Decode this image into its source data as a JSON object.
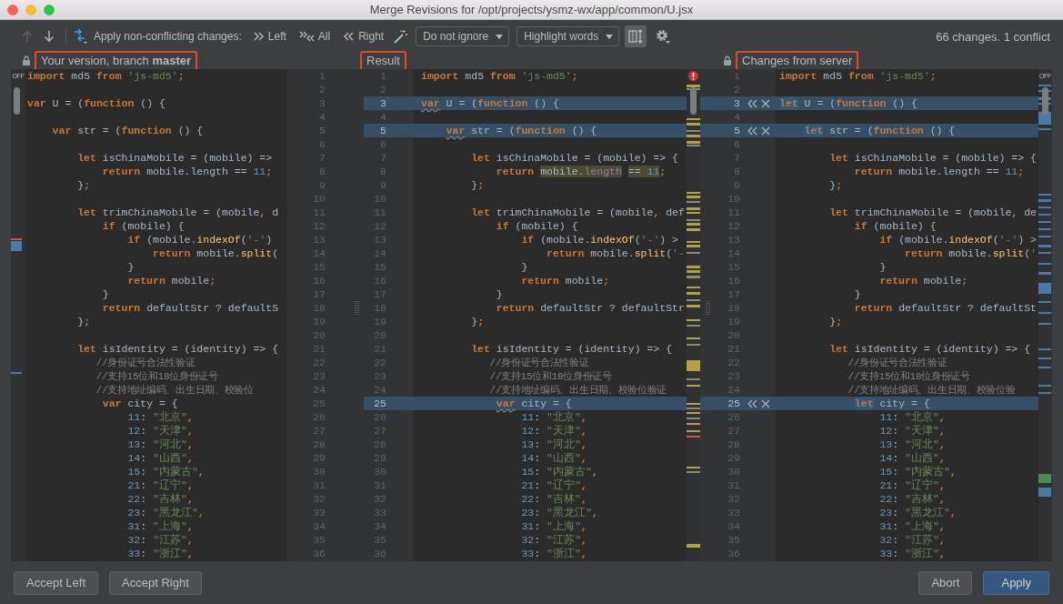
{
  "window": {
    "title": "Merge Revisions for /opt/projects/ysmz-wx/app/common/U.jsx"
  },
  "toolbar": {
    "navigation": [
      {
        "kind": "previous",
        "disabled": true
      },
      {
        "kind": "next",
        "disabled": false
      }
    ],
    "apply_label": "Apply non-conflicting changes:",
    "apply_buttons": [
      {
        "kind": "left",
        "label": "Left"
      },
      {
        "kind": "all",
        "label": "All"
      },
      {
        "kind": "right",
        "label": "Right"
      }
    ],
    "whitespace_dropdown": "Do not ignore",
    "highlight_dropdown": "Highlight words",
    "scroll_sync": {
      "on": true
    },
    "summary": "66 changes. 1 conflict"
  },
  "panes": [
    {
      "title": "Your version, branch **master**",
      "locked": true,
      "annotated": true,
      "inspection_label": "OFF",
      "lines": [
        {
          "number": "1",
          "code": [
            {
              "text": "import",
              "kind": "keyword"
            },
            {
              "text": " md5 ",
              "kind": "plain"
            },
            {
              "text": "from",
              "kind": "keyword"
            },
            {
              "text": " 'js-md5'",
              "kind": "string"
            },
            {
              "text": ";",
              "kind": "keyword"
            }
          ]
        },
        {
          "number": "2"
        },
        {
          "number": "3",
          "code": [
            {
              "text": "var",
              "kind": "keyword"
            },
            {
              "text": " U = (",
              "kind": "plain"
            },
            {
              "text": "function",
              "kind": "keyword"
            },
            {
              "text": " () {",
              "kind": "plain"
            }
          ]
        },
        {
          "number": "4"
        },
        {
          "number": "5",
          "code": [
            {
              "text": "    var",
              "kind": "keyword"
            },
            {
              "text": " str = (",
              "kind": "plain"
            },
            {
              "text": "function",
              "kind": "keyword"
            },
            {
              "text": " () {",
              "kind": "plain"
            }
          ]
        },
        {
          "number": "6"
        },
        {
          "number": "7",
          "code": [
            {
              "text": "        let",
              "kind": "keyword"
            },
            {
              "text": " isChinaMobile = (mobile) =>",
              "kind": "plain"
            }
          ]
        },
        {
          "number": "8",
          "code": [
            {
              "text": "            return",
              "kind": "keyword"
            },
            {
              "text": " mobile.length == ",
              "kind": "plain"
            },
            {
              "text": "11",
              "kind": "number"
            },
            {
              "text": ";",
              "kind": "keyword"
            }
          ]
        },
        {
          "number": "9",
          "code": [
            {
              "text": "        }",
              "kind": "plain"
            },
            {
              "text": ";",
              "kind": "keyword"
            }
          ]
        },
        {
          "number": "10"
        },
        {
          "number": "11",
          "code": [
            {
              "text": "        let",
              "kind": "keyword"
            },
            {
              "text": " trimChinaMobile = (mobile",
              "kind": "plain"
            },
            {
              "text": ",",
              "kind": "keyword"
            },
            {
              "text": " d",
              "kind": "plain"
            }
          ]
        },
        {
          "number": "12",
          "code": [
            {
              "text": "            if",
              "kind": "keyword"
            },
            {
              "text": " (mobile) {",
              "kind": "plain"
            }
          ]
        },
        {
          "number": "13",
          "code": [
            {
              "text": "                if",
              "kind": "keyword"
            },
            {
              "text": " (mobile.",
              "kind": "plain"
            },
            {
              "text": "indexOf",
              "kind": "method"
            },
            {
              "text": "(",
              "kind": "plain"
            },
            {
              "text": "'-'",
              "kind": "string"
            },
            {
              "text": ")",
              "kind": "plain"
            }
          ]
        },
        {
          "number": "14",
          "code": [
            {
              "text": "                    return",
              "kind": "keyword"
            },
            {
              "text": " mobile.",
              "kind": "plain"
            },
            {
              "text": "split",
              "kind": "method"
            },
            {
              "text": "(",
              "kind": "plain"
            }
          ]
        },
        {
          "number": "15",
          "code": [
            {
              "text": "                }",
              "kind": "plain"
            }
          ]
        },
        {
          "number": "16",
          "code": [
            {
              "text": "                return",
              "kind": "keyword"
            },
            {
              "text": " mobile",
              "kind": "plain"
            },
            {
              "text": ";",
              "kind": "keyword"
            }
          ]
        },
        {
          "number": "17",
          "code": [
            {
              "text": "            }",
              "kind": "plain"
            }
          ]
        },
        {
          "number": "18",
          "code": [
            {
              "text": "            return",
              "kind": "keyword"
            },
            {
              "text": " defaultStr ? defaultS",
              "kind": "plain"
            }
          ]
        },
        {
          "number": "19",
          "code": [
            {
              "text": "        }",
              "kind": "plain"
            },
            {
              "text": ";",
              "kind": "keyword"
            }
          ]
        },
        {
          "number": "20"
        },
        {
          "number": "21",
          "code": [
            {
              "text": "        let",
              "kind": "keyword"
            },
            {
              "text": " isIdentity = (identity) => {",
              "kind": "plain"
            }
          ]
        },
        {
          "number": "22",
          "code": [
            {
              "text": "            //身份证号合法性验证",
              "kind": "comment"
            }
          ]
        },
        {
          "number": "23",
          "code": [
            {
              "text": "            //支持15位和18位身份证号",
              "kind": "comment"
            }
          ]
        },
        {
          "number": "24",
          "code": [
            {
              "text": "            //支持地址编码、出生日期、校验位",
              "kind": "comment"
            }
          ]
        },
        {
          "number": "25",
          "code": [
            {
              "text": "            var",
              "kind": "keyword"
            },
            {
              "text": " city = {",
              "kind": "plain"
            }
          ]
        },
        {
          "number": "26",
          "code": [
            {
              "text": "                11",
              "kind": "number"
            },
            {
              "text": ": ",
              "kind": "plain"
            },
            {
              "text": "\"北京\"",
              "kind": "string"
            },
            {
              "text": ",",
              "kind": "keyword"
            }
          ]
        },
        {
          "number": "27",
          "code": [
            {
              "text": "                12",
              "kind": "number"
            },
            {
              "text": ": ",
              "kind": "plain"
            },
            {
              "text": "\"天津\"",
              "kind": "string"
            },
            {
              "text": ",",
              "kind": "keyword"
            }
          ]
        },
        {
          "number": "28",
          "code": [
            {
              "text": "                13",
              "kind": "number"
            },
            {
              "text": ": ",
              "kind": "plain"
            },
            {
              "text": "\"河北\"",
              "kind": "string"
            },
            {
              "text": ",",
              "kind": "keyword"
            }
          ]
        },
        {
          "number": "29",
          "code": [
            {
              "text": "                14",
              "kind": "number"
            },
            {
              "text": ": ",
              "kind": "plain"
            },
            {
              "text": "\"山西\"",
              "kind": "string"
            },
            {
              "text": ",",
              "kind": "keyword"
            }
          ]
        },
        {
          "number": "30",
          "code": [
            {
              "text": "                15",
              "kind": "number"
            },
            {
              "text": ": ",
              "kind": "plain"
            },
            {
              "text": "\"内蒙古\"",
              "kind": "string"
            },
            {
              "text": ",",
              "kind": "keyword"
            }
          ]
        },
        {
          "number": "31",
          "code": [
            {
              "text": "                21",
              "kind": "number"
            },
            {
              "text": ": ",
              "kind": "plain"
            },
            {
              "text": "\"辽宁\"",
              "kind": "string"
            },
            {
              "text": ",",
              "kind": "keyword"
            }
          ]
        },
        {
          "number": "32",
          "code": [
            {
              "text": "                22",
              "kind": "number"
            },
            {
              "text": ": ",
              "kind": "plain"
            },
            {
              "text": "\"吉林\"",
              "kind": "string"
            },
            {
              "text": ",",
              "kind": "keyword"
            }
          ]
        },
        {
          "number": "33",
          "code": [
            {
              "text": "                23",
              "kind": "number"
            },
            {
              "text": ": ",
              "kind": "plain"
            },
            {
              "text": "\"黑龙江\"",
              "kind": "string"
            },
            {
              "text": ",",
              "kind": "keyword"
            }
          ]
        },
        {
          "number": "34",
          "code": [
            {
              "text": "                31",
              "kind": "number"
            },
            {
              "text": ": ",
              "kind": "plain"
            },
            {
              "text": "\"上海\"",
              "kind": "string"
            },
            {
              "text": ",",
              "kind": "keyword"
            }
          ]
        },
        {
          "number": "35",
          "code": [
            {
              "text": "                32",
              "kind": "number"
            },
            {
              "text": ": ",
              "kind": "plain"
            },
            {
              "text": "\"江苏\"",
              "kind": "string"
            },
            {
              "text": ",",
              "kind": "keyword"
            }
          ]
        },
        {
          "number": "36",
          "code": [
            {
              "text": "                33",
              "kind": "number"
            },
            {
              "text": ": ",
              "kind": "plain"
            },
            {
              "text": "\"浙江\"",
              "kind": "string"
            },
            {
              "text": ",",
              "kind": "keyword"
            }
          ]
        }
      ]
    },
    {
      "title": "Result",
      "locked": false,
      "annotated": true,
      "has_errors": true,
      "lines": [
        {
          "number": "1",
          "changed": false,
          "code": [
            {
              "text": "import",
              "kind": "keyword"
            },
            {
              "text": " md5 ",
              "kind": "plain"
            },
            {
              "text": "from",
              "kind": "keyword"
            },
            {
              "text": " 'js-md5'",
              "kind": "string"
            },
            {
              "text": ";",
              "kind": "keyword"
            }
          ]
        },
        {
          "number": "2",
          "changed": false
        },
        {
          "number": "3",
          "changed": true,
          "code": [
            {
              "text": "var",
              "kind": "keyword",
              "underlined": true
            },
            {
              "text": " U = (",
              "kind": "plain"
            },
            {
              "text": "function",
              "kind": "keyword"
            },
            {
              "text": " () {",
              "kind": "plain"
            }
          ]
        },
        {
          "number": "4",
          "changed": false
        },
        {
          "number": "5",
          "changed": true,
          "code": [
            {
              "text": "    var",
              "kind": "keyword",
              "underlined": true
            },
            {
              "text": " str = (",
              "kind": "plain"
            },
            {
              "text": "function",
              "kind": "keyword"
            },
            {
              "text": " () {",
              "kind": "plain"
            }
          ]
        },
        {
          "number": "6",
          "changed": false
        },
        {
          "number": "7",
          "changed": false,
          "code": [
            {
              "text": "        let",
              "kind": "keyword"
            },
            {
              "text": " isChinaMobile = (mobile) => {",
              "kind": "plain"
            }
          ]
        },
        {
          "number": "8",
          "changed": false,
          "code": [
            {
              "text": "            return ",
              "kind": "keyword"
            },
            {
              "text": "mobile.",
              "kind": "plain",
              "highlighted": true
            },
            {
              "text": "length",
              "kind": "field",
              "highlighted": true
            },
            {
              "text": " == ",
              "kind": "plain",
              "highlighted": true
            },
            {
              "text": "11",
              "kind": "number",
              "highlighted": true
            },
            {
              "text": ";",
              "kind": "keyword"
            }
          ]
        },
        {
          "number": "9",
          "changed": false,
          "code": [
            {
              "text": "        }",
              "kind": "plain"
            },
            {
              "text": ";",
              "kind": "keyword"
            }
          ]
        },
        {
          "number": "10",
          "changed": false
        },
        {
          "number": "11",
          "changed": false,
          "code": [
            {
              "text": "        let",
              "kind": "keyword"
            },
            {
              "text": " trimChinaMobile = (mobile",
              "kind": "plain"
            },
            {
              "text": ",",
              "kind": "keyword"
            },
            {
              "text": " def",
              "kind": "plain"
            }
          ]
        },
        {
          "number": "12",
          "changed": false,
          "code": [
            {
              "text": "            if",
              "kind": "keyword"
            },
            {
              "text": " (mobile) {",
              "kind": "plain"
            }
          ]
        },
        {
          "number": "13",
          "changed": false,
          "code": [
            {
              "text": "                if",
              "kind": "keyword"
            },
            {
              "text": " (mobile.",
              "kind": "plain"
            },
            {
              "text": "indexOf",
              "kind": "method"
            },
            {
              "text": "(",
              "kind": "plain"
            },
            {
              "text": "'-'",
              "kind": "string"
            },
            {
              "text": ") >",
              "kind": "plain"
            }
          ]
        },
        {
          "number": "14",
          "changed": false,
          "code": [
            {
              "text": "                    return",
              "kind": "keyword"
            },
            {
              "text": " mobile.",
              "kind": "plain"
            },
            {
              "text": "split",
              "kind": "method"
            },
            {
              "text": "(",
              "kind": "plain"
            },
            {
              "text": "'-",
              "kind": "string"
            }
          ]
        },
        {
          "number": "15",
          "changed": false,
          "code": [
            {
              "text": "                }",
              "kind": "plain"
            }
          ]
        },
        {
          "number": "16",
          "changed": false,
          "code": [
            {
              "text": "                return",
              "kind": "keyword"
            },
            {
              "text": " mobile",
              "kind": "plain"
            },
            {
              "text": ";",
              "kind": "keyword"
            }
          ]
        },
        {
          "number": "17",
          "changed": false,
          "code": [
            {
              "text": "            }",
              "kind": "plain"
            }
          ]
        },
        {
          "number": "18",
          "changed": false,
          "code": [
            {
              "text": "            return",
              "kind": "keyword"
            },
            {
              "text": " defaultStr ? defaultStr",
              "kind": "plain"
            }
          ]
        },
        {
          "number": "19",
          "changed": false,
          "code": [
            {
              "text": "        }",
              "kind": "plain"
            },
            {
              "text": ";",
              "kind": "keyword"
            }
          ]
        },
        {
          "number": "20",
          "changed": false
        },
        {
          "number": "21",
          "changed": false,
          "code": [
            {
              "text": "        let",
              "kind": "keyword"
            },
            {
              "text": " isIdentity = (identity) => {",
              "kind": "plain"
            }
          ]
        },
        {
          "number": "22",
          "changed": false,
          "code": [
            {
              "text": "            //身份证号合法性验证",
              "kind": "comment"
            }
          ]
        },
        {
          "number": "23",
          "changed": false,
          "code": [
            {
              "text": "            //支持15位和18位身份证号",
              "kind": "comment"
            }
          ]
        },
        {
          "number": "24",
          "changed": false,
          "code": [
            {
              "text": "            //支持地址编码、出生日期、校验位验证",
              "kind": "comment"
            }
          ]
        },
        {
          "number": "25",
          "changed": true,
          "code": [
            {
              "text": "            var",
              "kind": "keyword",
              "underlined": true
            },
            {
              "text": " city = {",
              "kind": "plain"
            }
          ]
        },
        {
          "number": "26",
          "changed": false,
          "code": [
            {
              "text": "                11",
              "kind": "number"
            },
            {
              "text": ": ",
              "kind": "plain"
            },
            {
              "text": "\"北京\"",
              "kind": "string"
            },
            {
              "text": ",",
              "kind": "keyword"
            }
          ]
        },
        {
          "number": "27",
          "changed": false,
          "code": [
            {
              "text": "                12",
              "kind": "number"
            },
            {
              "text": ": ",
              "kind": "plain"
            },
            {
              "text": "\"天津\"",
              "kind": "string"
            },
            {
              "text": ",",
              "kind": "keyword"
            }
          ]
        },
        {
          "number": "28",
          "changed": false,
          "code": [
            {
              "text": "                13",
              "kind": "number"
            },
            {
              "text": ": ",
              "kind": "plain"
            },
            {
              "text": "\"河北\"",
              "kind": "string"
            },
            {
              "text": ",",
              "kind": "keyword"
            }
          ]
        },
        {
          "number": "29",
          "changed": false,
          "code": [
            {
              "text": "                14",
              "kind": "number"
            },
            {
              "text": ": ",
              "kind": "plain"
            },
            {
              "text": "\"山西\"",
              "kind": "string"
            },
            {
              "text": ",",
              "kind": "keyword"
            }
          ]
        },
        {
          "number": "30",
          "changed": false,
          "code": [
            {
              "text": "                15",
              "kind": "number"
            },
            {
              "text": ": ",
              "kind": "plain"
            },
            {
              "text": "\"内蒙古\"",
              "kind": "string"
            },
            {
              "text": ",",
              "kind": "keyword"
            }
          ]
        },
        {
          "number": "31",
          "changed": false,
          "code": [
            {
              "text": "                21",
              "kind": "number"
            },
            {
              "text": ": ",
              "kind": "plain"
            },
            {
              "text": "\"辽宁\"",
              "kind": "string"
            },
            {
              "text": ",",
              "kind": "keyword"
            }
          ]
        },
        {
          "number": "32",
          "changed": false,
          "code": [
            {
              "text": "                22",
              "kind": "number"
            },
            {
              "text": ": ",
              "kind": "plain"
            },
            {
              "text": "\"吉林\"",
              "kind": "string"
            },
            {
              "text": ",",
              "kind": "keyword"
            }
          ]
        },
        {
          "number": "33",
          "changed": false,
          "code": [
            {
              "text": "                23",
              "kind": "number"
            },
            {
              "text": ": ",
              "kind": "plain"
            },
            {
              "text": "\"黑龙江\"",
              "kind": "string"
            },
            {
              "text": ",",
              "kind": "keyword"
            }
          ]
        },
        {
          "number": "34",
          "changed": false,
          "code": [
            {
              "text": "                31",
              "kind": "number"
            },
            {
              "text": ": ",
              "kind": "plain"
            },
            {
              "text": "\"上海\"",
              "kind": "string"
            },
            {
              "text": ",",
              "kind": "keyword"
            }
          ]
        },
        {
          "number": "35",
          "changed": false,
          "code": [
            {
              "text": "                32",
              "kind": "number"
            },
            {
              "text": ": ",
              "kind": "plain"
            },
            {
              "text": "\"江苏\"",
              "kind": "string"
            },
            {
              "text": ",",
              "kind": "keyword"
            }
          ]
        },
        {
          "number": "36",
          "changed": false,
          "code": [
            {
              "text": "                33",
              "kind": "number"
            },
            {
              "text": ": ",
              "kind": "plain"
            },
            {
              "text": "\"浙江\"",
              "kind": "string"
            },
            {
              "text": ",",
              "kind": "keyword"
            }
          ]
        }
      ]
    },
    {
      "title": "Changes from server",
      "locked": true,
      "annotated": true,
      "inspection_label": "OFF",
      "lines": [
        {
          "number": "1",
          "changed": false,
          "code": [
            {
              "text": "import",
              "kind": "keyword"
            },
            {
              "text": " md5 ",
              "kind": "plain"
            },
            {
              "text": "from",
              "kind": "keyword"
            },
            {
              "text": " 'js-md5'",
              "kind": "string"
            },
            {
              "text": ";",
              "kind": "keyword"
            }
          ]
        },
        {
          "number": "2",
          "changed": false
        },
        {
          "number": "3",
          "changed": true,
          "code": [
            {
              "text": "let",
              "kind": "keyword",
              "highlighted": true
            },
            {
              "text": " U = (",
              "kind": "plain"
            },
            {
              "text": "function",
              "kind": "keyword"
            },
            {
              "text": " () {",
              "kind": "plain"
            }
          ]
        },
        {
          "number": "4",
          "changed": false
        },
        {
          "number": "5",
          "changed": true,
          "code": [
            {
              "text": "    let",
              "kind": "keyword",
              "highlighted": true
            },
            {
              "text": " str = (",
              "kind": "plain"
            },
            {
              "text": "function",
              "kind": "keyword"
            },
            {
              "text": " () {",
              "kind": "plain"
            }
          ]
        },
        {
          "number": "6",
          "changed": false
        },
        {
          "number": "7",
          "changed": false,
          "code": [
            {
              "text": "        let",
              "kind": "keyword"
            },
            {
              "text": " isChinaMobile = (mobile) => {",
              "kind": "plain"
            }
          ]
        },
        {
          "number": "8",
          "changed": false,
          "code": [
            {
              "text": "            return",
              "kind": "keyword"
            },
            {
              "text": " mobile.length == ",
              "kind": "plain"
            },
            {
              "text": "11",
              "kind": "number"
            },
            {
              "text": ";",
              "kind": "keyword"
            }
          ]
        },
        {
          "number": "9",
          "changed": false,
          "code": [
            {
              "text": "        }",
              "kind": "plain"
            },
            {
              "text": ";",
              "kind": "keyword"
            }
          ]
        },
        {
          "number": "10",
          "changed": false
        },
        {
          "number": "11",
          "changed": false,
          "code": [
            {
              "text": "        let",
              "kind": "keyword"
            },
            {
              "text": " trimChinaMobile = (mobile",
              "kind": "plain"
            },
            {
              "text": ",",
              "kind": "keyword"
            },
            {
              "text": " de",
              "kind": "plain"
            }
          ]
        },
        {
          "number": "12",
          "changed": false,
          "code": [
            {
              "text": "            if",
              "kind": "keyword"
            },
            {
              "text": " (mobile) {",
              "kind": "plain"
            }
          ]
        },
        {
          "number": "13",
          "changed": false,
          "code": [
            {
              "text": "                if",
              "kind": "keyword"
            },
            {
              "text": " (mobile.",
              "kind": "plain"
            },
            {
              "text": "indexOf",
              "kind": "method"
            },
            {
              "text": "(",
              "kind": "plain"
            },
            {
              "text": "'-'",
              "kind": "string"
            },
            {
              "text": ") >",
              "kind": "plain"
            }
          ]
        },
        {
          "number": "14",
          "changed": false,
          "code": [
            {
              "text": "                    return",
              "kind": "keyword"
            },
            {
              "text": " mobile.",
              "kind": "plain"
            },
            {
              "text": "split",
              "kind": "method"
            },
            {
              "text": "(",
              "kind": "plain"
            },
            {
              "text": "'",
              "kind": "string"
            }
          ]
        },
        {
          "number": "15",
          "changed": false,
          "code": [
            {
              "text": "                }",
              "kind": "plain"
            }
          ]
        },
        {
          "number": "16",
          "changed": false,
          "code": [
            {
              "text": "                return",
              "kind": "keyword"
            },
            {
              "text": " mobile",
              "kind": "plain"
            },
            {
              "text": ";",
              "kind": "keyword"
            }
          ]
        },
        {
          "number": "17",
          "changed": false,
          "code": [
            {
              "text": "            }",
              "kind": "plain"
            }
          ]
        },
        {
          "number": "18",
          "changed": false,
          "code": [
            {
              "text": "            return",
              "kind": "keyword"
            },
            {
              "text": " defaultStr ? defaultSt",
              "kind": "plain"
            }
          ]
        },
        {
          "number": "19",
          "changed": false,
          "code": [
            {
              "text": "        }",
              "kind": "plain"
            },
            {
              "text": ";",
              "kind": "keyword"
            }
          ]
        },
        {
          "number": "20",
          "changed": false
        },
        {
          "number": "21",
          "changed": false,
          "code": [
            {
              "text": "        let",
              "kind": "keyword"
            },
            {
              "text": " isIdentity = (identity) => {",
              "kind": "plain"
            }
          ]
        },
        {
          "number": "22",
          "changed": false,
          "code": [
            {
              "text": "            //身份证号合法性验证",
              "kind": "comment"
            }
          ]
        },
        {
          "number": "23",
          "changed": false,
          "code": [
            {
              "text": "            //支持15位和18位身份证号",
              "kind": "comment"
            }
          ]
        },
        {
          "number": "24",
          "changed": false,
          "code": [
            {
              "text": "            //支持地址编码、出生日期、校验位验",
              "kind": "comment"
            }
          ]
        },
        {
          "number": "25",
          "changed": true,
          "code": [
            {
              "text": "            let",
              "kind": "keyword",
              "highlighted": true
            },
            {
              "text": " city = {",
              "kind": "plain"
            }
          ]
        },
        {
          "number": "26",
          "changed": false,
          "code": [
            {
              "text": "                11",
              "kind": "number"
            },
            {
              "text": ": ",
              "kind": "plain"
            },
            {
              "text": "\"北京\"",
              "kind": "string"
            },
            {
              "text": ",",
              "kind": "keyword"
            }
          ]
        },
        {
          "number": "27",
          "changed": false,
          "code": [
            {
              "text": "                12",
              "kind": "number"
            },
            {
              "text": ": ",
              "kind": "plain"
            },
            {
              "text": "\"天津\"",
              "kind": "string"
            },
            {
              "text": ",",
              "kind": "keyword"
            }
          ]
        },
        {
          "number": "28",
          "changed": false,
          "code": [
            {
              "text": "                13",
              "kind": "number"
            },
            {
              "text": ": ",
              "kind": "plain"
            },
            {
              "text": "\"河北\"",
              "kind": "string"
            },
            {
              "text": ",",
              "kind": "keyword"
            }
          ]
        },
        {
          "number": "29",
          "changed": false,
          "code": [
            {
              "text": "                14",
              "kind": "number"
            },
            {
              "text": ": ",
              "kind": "plain"
            },
            {
              "text": "\"山西\"",
              "kind": "string"
            },
            {
              "text": ",",
              "kind": "keyword"
            }
          ]
        },
        {
          "number": "30",
          "changed": false,
          "code": [
            {
              "text": "                15",
              "kind": "number"
            },
            {
              "text": ": ",
              "kind": "plain"
            },
            {
              "text": "\"内蒙古\"",
              "kind": "string"
            },
            {
              "text": ",",
              "kind": "keyword"
            }
          ]
        },
        {
          "number": "31",
          "changed": false,
          "code": [
            {
              "text": "                21",
              "kind": "number"
            },
            {
              "text": ": ",
              "kind": "plain"
            },
            {
              "text": "\"辽宁\"",
              "kind": "string"
            },
            {
              "text": ",",
              "kind": "keyword"
            }
          ]
        },
        {
          "number": "32",
          "changed": false,
          "code": [
            {
              "text": "                22",
              "kind": "number"
            },
            {
              "text": ": ",
              "kind": "plain"
            },
            {
              "text": "\"吉林\"",
              "kind": "string"
            },
            {
              "text": ",",
              "kind": "keyword"
            }
          ]
        },
        {
          "number": "33",
          "changed": false,
          "code": [
            {
              "text": "                23",
              "kind": "number"
            },
            {
              "text": ": ",
              "kind": "plain"
            },
            {
              "text": "\"黑龙江\"",
              "kind": "string"
            },
            {
              "text": ",",
              "kind": "keyword"
            }
          ]
        },
        {
          "number": "34",
          "changed": false,
          "code": [
            {
              "text": "                31",
              "kind": "number"
            },
            {
              "text": ": ",
              "kind": "plain"
            },
            {
              "text": "\"上海\"",
              "kind": "string"
            },
            {
              "text": ",",
              "kind": "keyword"
            }
          ]
        },
        {
          "number": "35",
          "changed": false,
          "code": [
            {
              "text": "                32",
              "kind": "number"
            },
            {
              "text": ": ",
              "kind": "plain"
            },
            {
              "text": "\"江苏\"",
              "kind": "string"
            },
            {
              "text": ",",
              "kind": "keyword"
            }
          ]
        },
        {
          "number": "36",
          "changed": false,
          "code": [
            {
              "text": "                33",
              "kind": "number"
            },
            {
              "text": ": ",
              "kind": "plain"
            },
            {
              "text": "\"浙江\"",
              "kind": "string"
            },
            {
              "text": ",",
              "kind": "keyword"
            }
          ]
        }
      ]
    }
  ],
  "footer": {
    "left_buttons": [
      {
        "label": "Accept Left",
        "primary": false
      },
      {
        "label": "Accept Right",
        "primary": false
      }
    ],
    "right_buttons": [
      {
        "label": "Abort",
        "primary": false
      },
      {
        "label": "Apply",
        "primary": true
      }
    ]
  }
}
